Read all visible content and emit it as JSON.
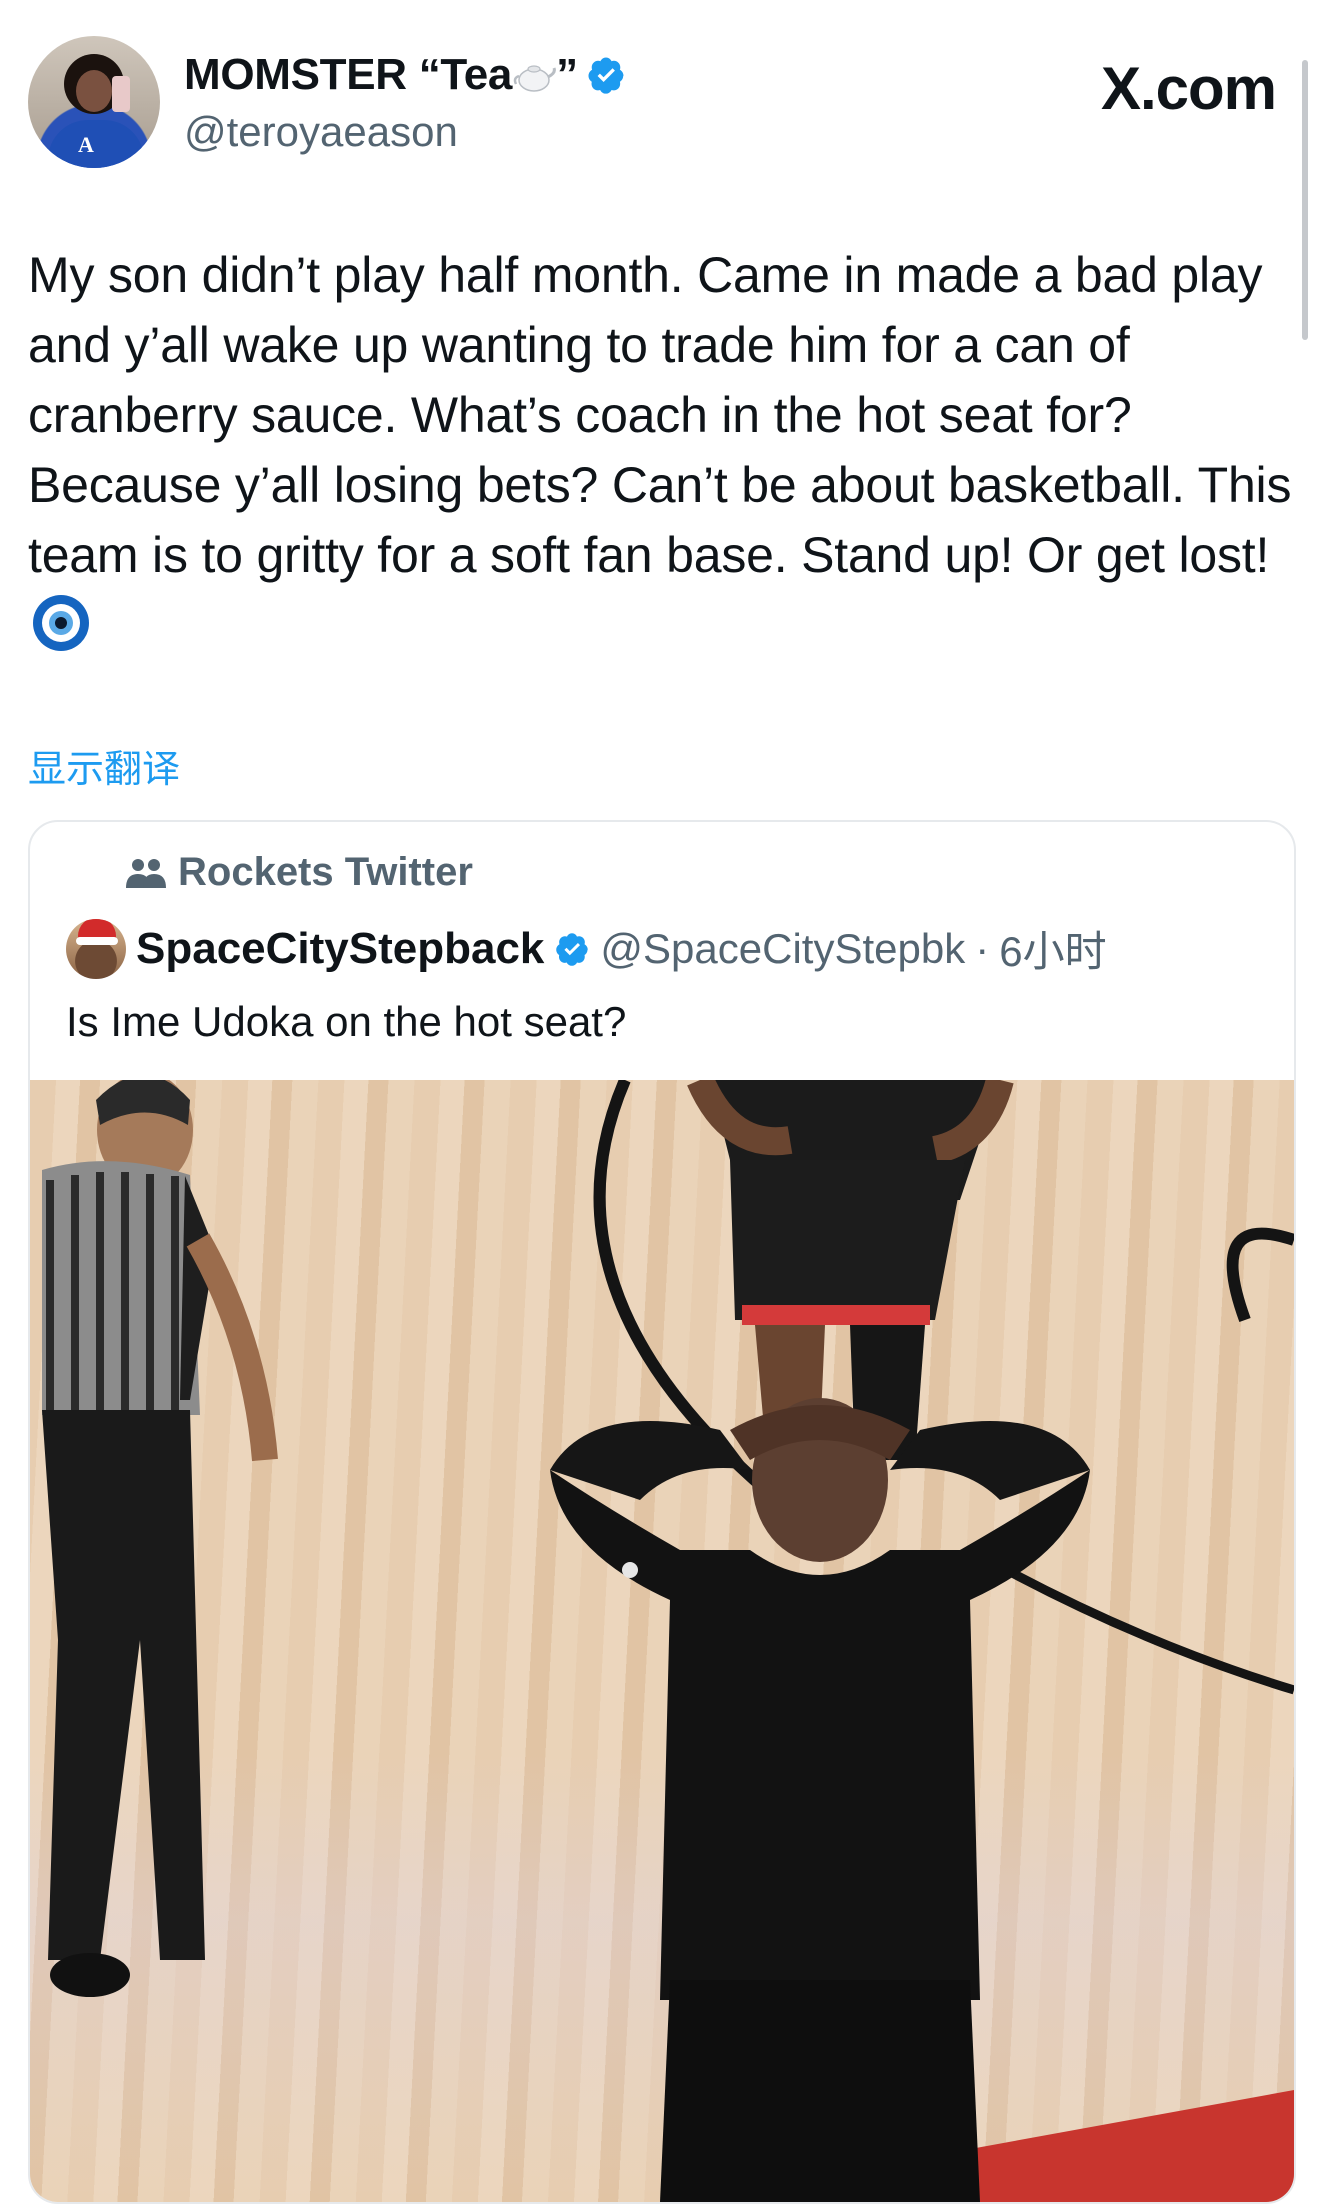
{
  "header": {
    "display_name": "MOMSTER “Tea",
    "display_name_suffix": "”",
    "handle": "@teroyaeason",
    "brand": "X.com"
  },
  "tweet": {
    "text": "My son didn’t play half month. Came in made a bad play and y’all wake up wanting to trade him for a can of cranberry sauce. What’s coach in the hot seat for? Because y’all losing bets? Can’t be about basketball. This team is to gritty for a soft fan base. Stand up! Or get lost!",
    "show_translation": "显示翻译"
  },
  "quote": {
    "community": "Rockets Twitter",
    "author_name": "SpaceCityStepback",
    "author_handle": "@SpaceCityStepbk",
    "separator": "·",
    "time": "6小时",
    "text": "Is Ime Udoka on the hot seat?"
  },
  "colors": {
    "accent": "#1d9bf0",
    "secondary_text": "#536471",
    "primary_text": "#0f1419"
  },
  "icons": [
    "teapot-emoji",
    "verified-badge-icon",
    "nazar-amulet-emoji",
    "community-people-icon"
  ]
}
